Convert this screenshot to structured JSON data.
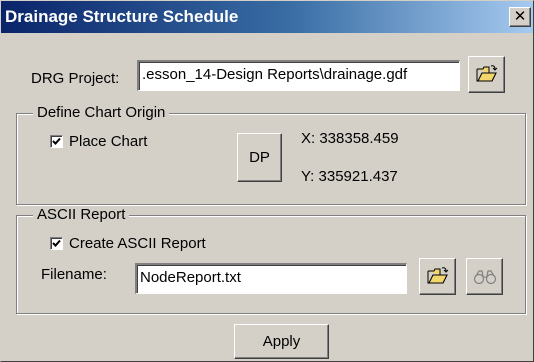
{
  "window": {
    "title": "Drainage Structure Schedule",
    "close_glyph": "✕"
  },
  "project": {
    "label": "DRG Project:",
    "value": ".esson_14-Design Reports\\drainage.gdf",
    "browse_icon": "open-folder-icon"
  },
  "chart_origin": {
    "legend": "Define Chart Origin",
    "place_chart_label": "Place Chart",
    "place_chart_checked": true,
    "dp_label": "DP",
    "x_readout": "X: 338358.459",
    "y_readout": "Y: 335921.437"
  },
  "ascii_report": {
    "legend": "ASCII Report",
    "create_label": "Create ASCII Report",
    "create_checked": true,
    "filename_label": "Filename:",
    "filename_value": "NodeReport.txt",
    "browse_icon": "open-folder-icon",
    "view_icon": "binoculars-icon"
  },
  "footer": {
    "apply_label": "Apply"
  },
  "colors": {
    "dialog_bg": "#d4d0c8",
    "title_start": "#0a246a",
    "title_end": "#a6caf0",
    "folder_yellow": "#f2d66b"
  }
}
